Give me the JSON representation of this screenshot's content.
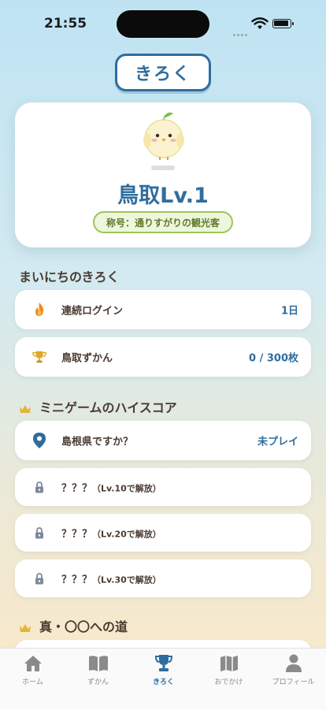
{
  "status": {
    "time": "21:55"
  },
  "header": {
    "title": "きろく"
  },
  "profile": {
    "level_text": "鳥取Lv.1",
    "title_badge": "称号：通りすがりの観光客",
    "mascot_icon": "chick-mascot-icon"
  },
  "daily": {
    "title": "まいにちのきろく",
    "items": [
      {
        "icon": "fire-icon",
        "label": "連続ログイン",
        "value": "1日"
      },
      {
        "icon": "trophy-icon",
        "label": "鳥取ずかん",
        "value": "0 / 300枚"
      }
    ]
  },
  "minigame": {
    "title": "ミニゲームのハイスコア",
    "items": [
      {
        "icon": "map-pin-icon",
        "label": "島根県ですか？",
        "value": "未プレイ"
      },
      {
        "icon": "lock-icon",
        "label": "？？？",
        "note": "（Lv.10で解放）"
      },
      {
        "icon": "lock-icon",
        "label": "？？？",
        "note": "（Lv.20で解放）"
      },
      {
        "icon": "lock-icon",
        "label": "？？？",
        "note": "（Lv.30で解放）"
      }
    ]
  },
  "road": {
    "title": "真・〇〇への道"
  },
  "tabs": [
    {
      "icon": "home-icon",
      "label": "ホーム"
    },
    {
      "icon": "book-icon",
      "label": "ずかん"
    },
    {
      "icon": "trophy-icon",
      "label": "きろく",
      "active": true
    },
    {
      "icon": "map-icon",
      "label": "おでかけ"
    },
    {
      "icon": "person-icon",
      "label": "プロフィール"
    }
  ],
  "colors": {
    "accent": "#2f6d9d",
    "badge_bg": "#eef6dc",
    "badge_border": "#9bc65a",
    "gold": "#e0a828",
    "fire": "#f08a24"
  }
}
